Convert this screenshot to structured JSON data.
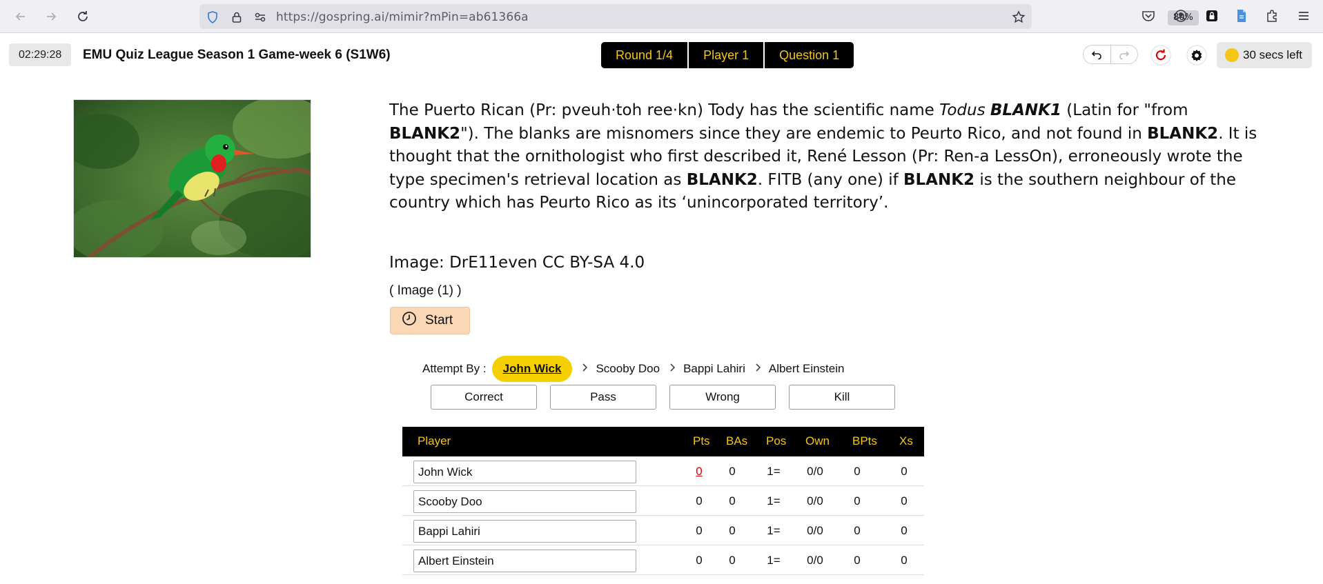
{
  "browser": {
    "url": "https://gospring.ai/mimir?mPin=ab61366a",
    "zoom": "80%"
  },
  "header": {
    "timer": "02:29:28",
    "title": "EMU Quiz League Season 1 Game-week 6 (S1W6)",
    "pills": [
      "Round 1/4",
      "Player 1",
      "Question 1"
    ],
    "secs_left": "30 secs left"
  },
  "question": {
    "text_html": "The Puerto Rican (Pr: pveuh·toh ree·kn) Tody has the scientific name <i>Todus</i> <b><i>BLANK1</i></b> (Latin for \"from <b>BLANK2</b>\"). The blanks are misnomers since they are endemic to Peurto Rico, and not found in <b>BLANK2</b>. It is thought that the ornithologist who first described it, René Lesson (Pr: Ren-a LessOn), erroneously wrote the type specimen's retrieval location as <b>BLANK2</b>. FITB (any one) if <b>BLANK2</b> is the southern neighbour of the country which has Peurto Rico as its ‘unincorporated territory’.",
    "credit": "Image: DrE11even CC BY-SA 4.0",
    "image_count": "( Image (1) )",
    "start_label": "Start"
  },
  "attempt": {
    "label": "Attempt By :",
    "current": "John Wick",
    "others": [
      "Scooby Doo",
      "Bappi Lahiri",
      "Albert Einstein"
    ]
  },
  "actions": [
    "Correct",
    "Pass",
    "Wrong",
    "Kill"
  ],
  "table": {
    "headers": [
      "Player",
      "Pts",
      "BAs",
      "Pos",
      "Own",
      "BPts",
      "Xs"
    ],
    "rows": [
      {
        "player": "John Wick",
        "pts": "0",
        "bas": "0",
        "pos": "1=",
        "own": "0/0",
        "bpts": "0",
        "xs": "0"
      },
      {
        "player": "Scooby Doo",
        "pts": "0",
        "bas": "0",
        "pos": "1=",
        "own": "0/0",
        "bpts": "0",
        "xs": "0"
      },
      {
        "player": "Bappi Lahiri",
        "pts": "0",
        "bas": "0",
        "pos": "1=",
        "own": "0/0",
        "bpts": "0",
        "xs": "0"
      },
      {
        "player": "Albert Einstein",
        "pts": "0",
        "bas": "0",
        "pos": "1=",
        "own": "0/0",
        "bpts": "0",
        "xs": "0"
      }
    ]
  },
  "colors": {
    "accent_yellow": "#f5c518",
    "pill_bg": "#000000",
    "start_bg": "#fad7b5",
    "pts_red": "#dd0000"
  },
  "icons": [
    "back-arrow-icon",
    "forward-arrow-icon",
    "reload-icon",
    "shield-icon",
    "lock-icon",
    "permissions-icon",
    "bookmark-star-icon",
    "pocket-icon",
    "account-icon",
    "extension-icon",
    "menu-icon",
    "undo-icon",
    "redo-icon",
    "reset-icon",
    "gear-icon",
    "clock-icon",
    "chevron-right-icon"
  ]
}
